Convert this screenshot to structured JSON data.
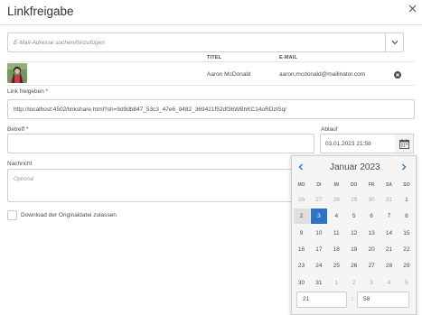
{
  "dialog": {
    "title": "Linkfreigabe"
  },
  "search": {
    "placeholder": "E-Mail-Adresse suchen/hinzufügen"
  },
  "recipients": {
    "headers": {
      "title": "TITEL",
      "email": "E-MAIL"
    },
    "rows": [
      {
        "name": "Aaron McDonald",
        "email": "aaron.mcdonald@mailinator.com"
      }
    ]
  },
  "share_link": {
    "label": "Link freigeben *",
    "value": "http://localhost:4502/linkshare.html?sh=9d9db847_53c3_47e6_9482_369421f52df36WBhKC14oRDzlSq/"
  },
  "subject": {
    "label": "Betreff *",
    "value": ""
  },
  "expiry": {
    "label": "Ablauf",
    "value": "03.01.2023 21:58"
  },
  "message": {
    "label": "Nachricht",
    "placeholder": "Optional"
  },
  "download_option": {
    "label": "Download der Originaldatei zulassen",
    "checked": false
  },
  "calendar": {
    "month_label": "Januar 2023",
    "weekdays": [
      "MO",
      "DI",
      "MI",
      "DO",
      "FR",
      "SA",
      "SO"
    ],
    "weeks": [
      [
        {
          "d": "26",
          "o": true
        },
        {
          "d": "27",
          "o": true
        },
        {
          "d": "28",
          "o": true
        },
        {
          "d": "29",
          "o": true
        },
        {
          "d": "30",
          "o": true
        },
        {
          "d": "31",
          "o": true
        },
        {
          "d": "1",
          "o": false
        }
      ],
      [
        {
          "d": "2",
          "o": false,
          "t": true
        },
        {
          "d": "3",
          "o": false,
          "s": true
        },
        {
          "d": "4",
          "o": false
        },
        {
          "d": "5",
          "o": false
        },
        {
          "d": "6",
          "o": false
        },
        {
          "d": "7",
          "o": false
        },
        {
          "d": "8",
          "o": false
        }
      ],
      [
        {
          "d": "9",
          "o": false
        },
        {
          "d": "10",
          "o": false
        },
        {
          "d": "11",
          "o": false
        },
        {
          "d": "12",
          "o": false
        },
        {
          "d": "13",
          "o": false
        },
        {
          "d": "14",
          "o": false
        },
        {
          "d": "15",
          "o": false
        }
      ],
      [
        {
          "d": "16",
          "o": false
        },
        {
          "d": "17",
          "o": false
        },
        {
          "d": "18",
          "o": false
        },
        {
          "d": "19",
          "o": false
        },
        {
          "d": "20",
          "o": false
        },
        {
          "d": "21",
          "o": false
        },
        {
          "d": "22",
          "o": false
        }
      ],
      [
        {
          "d": "23",
          "o": false
        },
        {
          "d": "24",
          "o": false
        },
        {
          "d": "25",
          "o": false
        },
        {
          "d": "26",
          "o": false
        },
        {
          "d": "27",
          "o": false
        },
        {
          "d": "28",
          "o": false
        },
        {
          "d": "29",
          "o": false
        }
      ],
      [
        {
          "d": "30",
          "o": false
        },
        {
          "d": "31",
          "o": false
        },
        {
          "d": "1",
          "o": true
        },
        {
          "d": "2",
          "o": true
        },
        {
          "d": "3",
          "o": true
        },
        {
          "d": "4",
          "o": true
        },
        {
          "d": "5",
          "o": true
        }
      ]
    ],
    "hour": "21",
    "minute": "58",
    "time_separator": ":"
  },
  "colors": {
    "accent": "#2d74c4",
    "today_bg": "#dedede"
  },
  "icons": {
    "close": "close-icon",
    "dropdown": "chevron-down-icon",
    "remove": "remove-circle-icon",
    "calendar": "calendar-icon",
    "prev": "chevron-left-icon",
    "next": "chevron-right-icon"
  }
}
